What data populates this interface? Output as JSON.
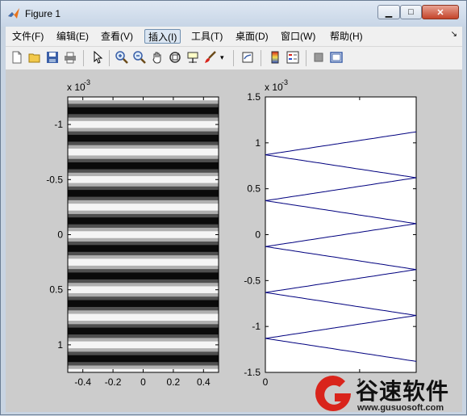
{
  "window": {
    "title": "Figure 1",
    "controls": {
      "minimize": "▁",
      "maximize": "□",
      "close": "✕"
    }
  },
  "menu": {
    "items": [
      "文件(F)",
      "编辑(E)",
      "查看(V)",
      "插入(I)",
      "工具(T)",
      "桌面(D)",
      "窗口(W)",
      "帮助(H)"
    ],
    "active": "插入(I)"
  },
  "toolbar": {
    "icons": [
      "new-figure-icon",
      "open-icon",
      "save-icon",
      "print-icon",
      "edit-plot-arrow-icon",
      "zoom-in-icon",
      "zoom-out-icon",
      "pan-hand-icon",
      "rotate-3d-icon",
      "data-cursor-icon",
      "brush-icon",
      "brush-dropdown-icon",
      "link-plot-icon",
      "colorbar-icon",
      "legend-icon",
      "hide-plot-tools-icon",
      "show-plot-tools-icon"
    ]
  },
  "chart_data": [
    {
      "type": "heatmap",
      "description_source": "left axes: grayscale horizontal-band image",
      "exponent_label": "x 10",
      "exponent_power": "-3",
      "xlim": [
        -0.5,
        0.5
      ],
      "ylim": [
        -1.25,
        1.25
      ],
      "y_direction": "reversed",
      "xticks": [
        "-0.4",
        "-0.2",
        "0",
        "0.2",
        "0.4"
      ],
      "yticks": [
        "-1",
        "-0.5",
        "0",
        "0.5",
        "1"
      ],
      "colormap": "gray",
      "bands_per_period": 8,
      "periods": 10
    },
    {
      "type": "line",
      "exponent_label": "x 10",
      "exponent_power": "-3",
      "xlim": [
        0,
        1.6
      ],
      "ylim": [
        -1.5,
        1.5
      ],
      "xticks": [
        "0",
        "1"
      ],
      "yticks": [
        "1.5",
        "1",
        "0.5",
        "0",
        "-0.5",
        "-1",
        "-1.5"
      ],
      "series_color": "#00007f",
      "crossings_y": [
        1.12,
        0.87,
        0.62,
        0.37,
        0.12,
        -0.13,
        -0.38,
        -0.63,
        -0.88,
        -1.13
      ]
    }
  ],
  "watermark": {
    "brand_cn": "谷速软件",
    "url": "www.gusuosoft.com",
    "brand_red": "#d9241b"
  }
}
